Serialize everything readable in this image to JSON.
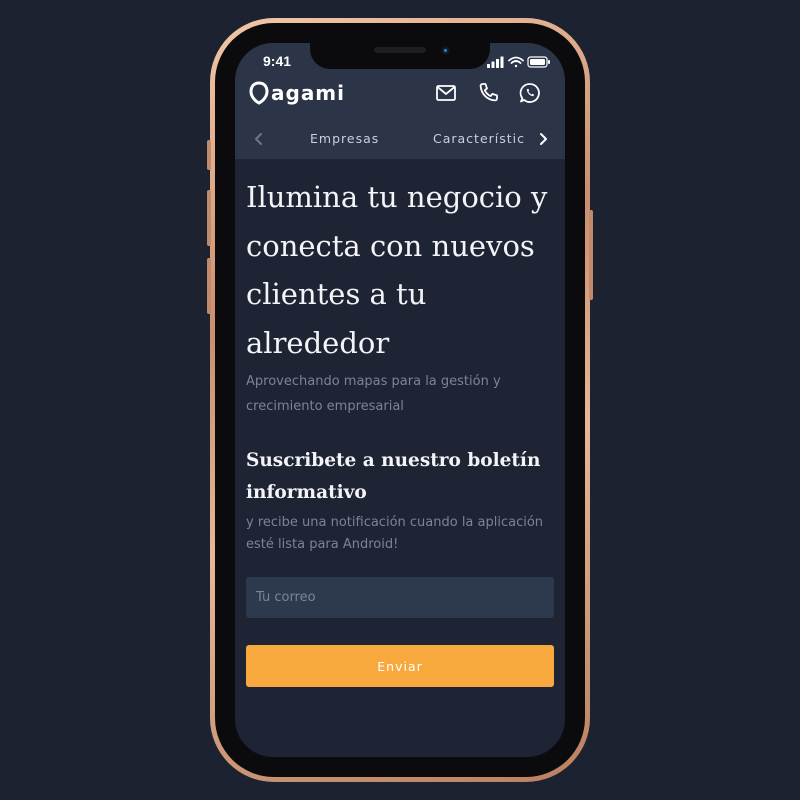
{
  "status_bar": {
    "time": "9:41"
  },
  "header": {
    "logo_text": "agami",
    "icons": [
      "mail-icon",
      "phone-icon",
      "whatsapp-icon"
    ]
  },
  "nav": {
    "items": [
      {
        "label": "Empresas"
      },
      {
        "label": "Característic"
      }
    ]
  },
  "hero": {
    "title": "Ilumina tu negocio y conecta con nuevos clientes a tu alrededor",
    "subtitle": "Aprovechando mapas para la gestión y crecimiento empresarial"
  },
  "newsletter": {
    "title": "Suscribete a nuestro boletín informativo",
    "subtitle": "y recibe una notificación cuando la aplicación esté lista para Android!",
    "email_placeholder": "Tu correo",
    "email_value": "",
    "button_label": "Enviar"
  },
  "colors": {
    "page_bg": "#1c2230",
    "screen_bg": "#1e2433",
    "header_bg": "#2b3547",
    "accent": "#f8a93e",
    "input_bg": "#2d3a4d"
  }
}
